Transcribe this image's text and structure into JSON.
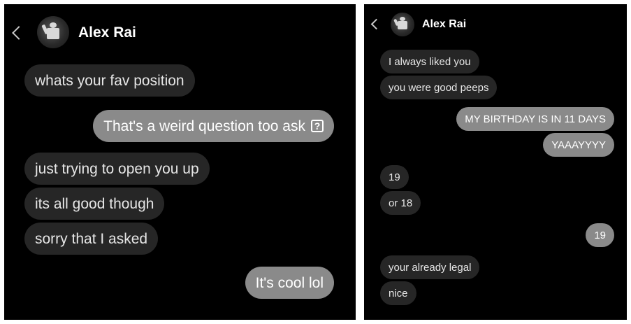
{
  "left_panel": {
    "header": {
      "contact_name": "Alex Rai"
    },
    "messages": [
      {
        "from": "them",
        "text": "whats your fav position"
      },
      {
        "from": "me",
        "text": "That's a weird question too ask",
        "icon": "question-box-icon",
        "icon_glyph": "?"
      },
      {
        "from": "them",
        "text": "just trying to open you up"
      },
      {
        "from": "them",
        "text": "its all good though"
      },
      {
        "from": "them",
        "text": "sorry that I asked"
      },
      {
        "from": "me",
        "text": "It's cool lol"
      }
    ]
  },
  "right_panel": {
    "header": {
      "contact_name": "Alex Rai"
    },
    "messages": [
      {
        "from": "them",
        "text": "I always liked you"
      },
      {
        "from": "them",
        "text": "you were good peeps"
      },
      {
        "from": "me",
        "text": "MY BIRTHDAY IS IN 11 DAYS"
      },
      {
        "from": "me",
        "text": "YAAAYYYY"
      },
      {
        "from": "them",
        "text": "19"
      },
      {
        "from": "them",
        "text": "or 18"
      },
      {
        "from": "me",
        "text": "19"
      },
      {
        "from": "them",
        "text": "your already legal"
      },
      {
        "from": "them",
        "text": "nice"
      }
    ]
  },
  "colors": {
    "background": "#000000",
    "incoming_bubble": "#262626",
    "outgoing_bubble": "#8a8a8a",
    "frame": "#ffffff"
  }
}
